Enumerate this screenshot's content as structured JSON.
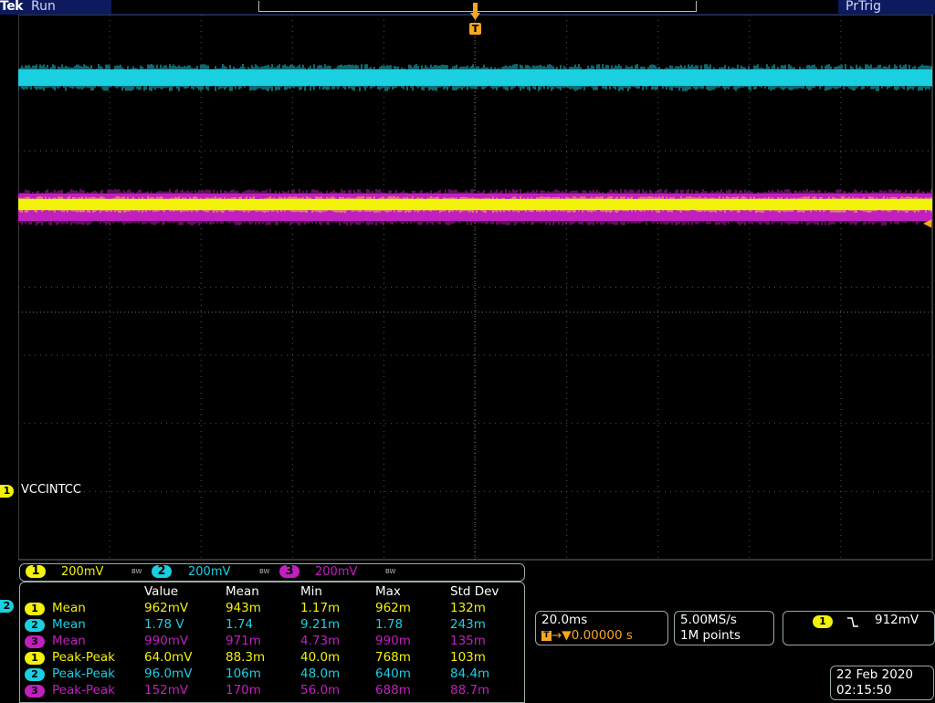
{
  "header": {
    "brand": "Tek",
    "status": "Run",
    "trigger_state": "PrTrig"
  },
  "trigger": {
    "marker": "T"
  },
  "channels": {
    "ch1": {
      "number": "1",
      "label": "VCCINTCC",
      "scale": "200mV",
      "color": "#f2f20a"
    },
    "ch2": {
      "number": "2",
      "scale": "200mV",
      "color": "#1ad0e0"
    },
    "ch3": {
      "number": "3",
      "scale": "200mV",
      "color": "#c21fbf"
    },
    "bw_mark": "BW"
  },
  "measurements": {
    "headers": [
      "Value",
      "Mean",
      "Min",
      "Max",
      "Std Dev"
    ],
    "rows": [
      {
        "channel": "1",
        "name": "Mean",
        "value": "962mV",
        "mean": "943m",
        "min": "1.17m",
        "max": "962m",
        "std": "132m"
      },
      {
        "channel": "2",
        "name": "Mean",
        "value": "1.78 V",
        "mean": "1.74",
        "min": "9.21m",
        "max": "1.78",
        "std": "243m"
      },
      {
        "channel": "3",
        "name": "Mean",
        "value": "990mV",
        "mean": "971m",
        "min": "4.73m",
        "max": "990m",
        "std": "135m"
      },
      {
        "channel": "1",
        "name": "Peak-Peak",
        "value": "64.0mV",
        "mean": "88.3m",
        "min": "40.0m",
        "max": "768m",
        "std": "103m"
      },
      {
        "channel": "2",
        "name": "Peak-Peak",
        "value": "96.0mV",
        "mean": "106m",
        "min": "48.0m",
        "max": "640m",
        "std": "84.4m"
      },
      {
        "channel": "3",
        "name": "Peak-Peak",
        "value": "152mV",
        "mean": "170m",
        "min": "56.0m",
        "max": "688m",
        "std": "88.7m"
      }
    ]
  },
  "horizontal": {
    "scale": "20.0ms",
    "delay": "0.00000 s"
  },
  "acquisition": {
    "sample_rate": "5.00MS/s",
    "record_length": "1M points"
  },
  "trigger_info": {
    "source": "1",
    "slope_icon": "falling-edge-icon",
    "level": "912mV"
  },
  "datetime": {
    "date": "22 Feb 2020",
    "time": "02:15:50"
  }
}
